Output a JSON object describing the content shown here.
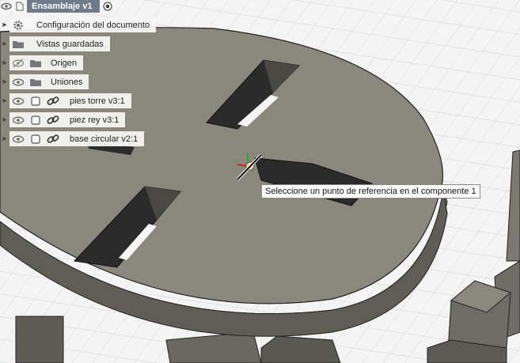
{
  "browser": {
    "root": {
      "label": "Ensamblaje v1"
    },
    "items": [
      {
        "label": "Configuración del documento",
        "icon": "gear-icon"
      },
      {
        "label": "Vistas guardadas",
        "icon": "folder-icon"
      },
      {
        "label": "Origen",
        "icon": "folder-icon",
        "visibility": "hidden"
      },
      {
        "label": "Uniones",
        "icon": "folder-icon",
        "visibility": "visible"
      },
      {
        "label": "pies torre v3:1",
        "icon": "component-icon",
        "visibility": "visible",
        "linked": true
      },
      {
        "label": "piez rey v3:1",
        "icon": "component-icon",
        "visibility": "visible",
        "linked": true
      },
      {
        "label": "base circular v2:1",
        "icon": "component-icon",
        "visibility": "visible",
        "linked": true
      }
    ]
  },
  "tooltip": {
    "text": "Seleccione un punto de referencia en el componente 1"
  },
  "colors": {
    "disk_top": "#8a877d",
    "disk_side": "#6c6a62",
    "slot_dark": "#2b2b2b",
    "root_bar": "#6e7b8b"
  }
}
